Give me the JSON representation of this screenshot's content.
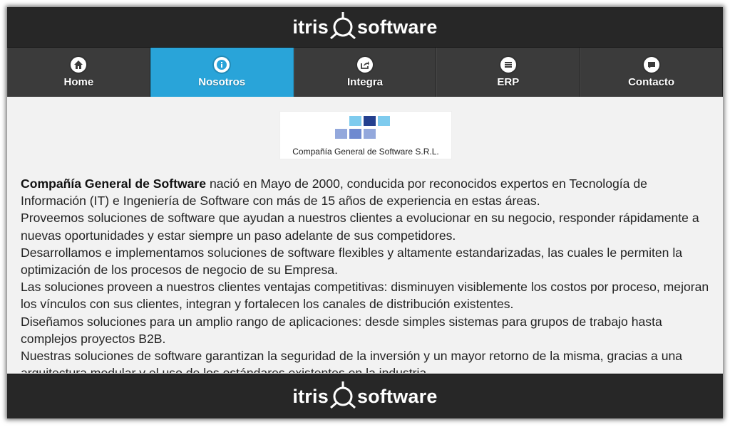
{
  "header": {
    "logo_left": "itris",
    "logo_right": "software"
  },
  "nav": {
    "items": [
      {
        "label": "Home",
        "icon": "home-icon"
      },
      {
        "label": "Nosotros",
        "icon": "info-icon",
        "active": true
      },
      {
        "label": "Integra",
        "icon": "share-icon"
      },
      {
        "label": "ERP",
        "icon": "menu-icon"
      },
      {
        "label": "Contacto",
        "icon": "chat-icon"
      }
    ],
    "active_color": "#29a4d9"
  },
  "company_logo": {
    "name": "Compañía General de Software S.R.L."
  },
  "about": {
    "intro_bold": "Compañía General de Software",
    "intro_rest": " nació en Mayo de 2000, conducida por reconocidos expertos en Tecnología de Información (IT) e Ingeniería de Software con más de 15 años de experiencia en estas áreas.",
    "paragraphs": [
      "Proveemos soluciones de software que ayudan a nuestros clientes a evolucionar en su negocio, responder rápidamente a nuevas oportunidades y estar siempre un paso adelante de sus competidores.",
      "Desarrollamos e implementamos soluciones de software flexibles y altamente estandarizadas, las cuales le permiten la optimización de los procesos de negocio de su Empresa.",
      "Las soluciones proveen a nuestros clientes ventajas competitivas: disminuyen visiblemente los costos por proceso, mejoran los vínculos con sus clientes, integran y fortalecen los canales de distribución existentes.",
      "Diseñamos soluciones para un amplio rango de aplicaciones: desde simples sistemas para grupos de trabajo hasta complejos proyectos B2B.",
      "Nuestras soluciones de software garantizan la seguridad de la inversión y un mayor retorno de la misma, gracias a una arquitectura modular y el uso de los estándares existentes en la industria."
    ]
  },
  "footer": {
    "logo_left": "itris",
    "logo_right": "software"
  }
}
